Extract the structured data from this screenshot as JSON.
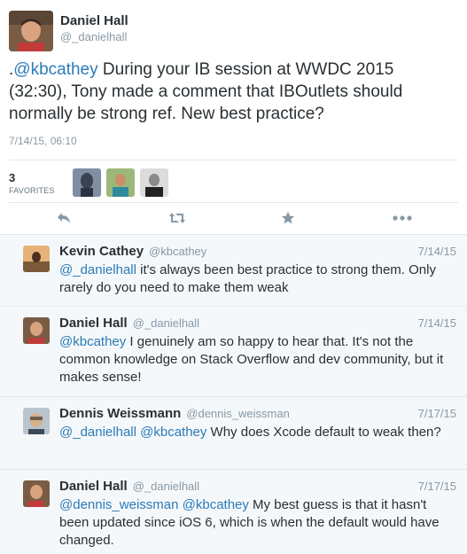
{
  "main": {
    "author_name": "Daniel Hall",
    "author_handle": "@_danielhall",
    "tweet_prefix": ".",
    "tweet_mention": "@kbcathey",
    "tweet_body": " During your IB session at WWDC 2015 (32:30), Tony made a comment that IBOutlets should normally be strong ref. New best practice?",
    "timestamp": "7/14/15, 06:10",
    "favorites_count": "3",
    "favorites_label": "FAVORITES"
  },
  "actions": {
    "reply_icon": "reply-icon",
    "retweet_icon": "retweet-icon",
    "favorite_icon": "star-icon",
    "more_icon": "more-icon"
  },
  "replies": [
    {
      "name": "Kevin Cathey",
      "handle": "@kbcathey",
      "date": "7/14/15",
      "mentions": "@_danielhall",
      "text": " it's always been best practice to strong them. Only rarely do you need to make them weak"
    },
    {
      "name": "Daniel Hall",
      "handle": "@_danielhall",
      "date": "7/14/15",
      "mentions": "@kbcathey",
      "text": " I genuinely am so happy to hear that. It's not the common knowledge on Stack Overflow and dev community, but it makes sense!"
    },
    {
      "name": "Dennis Weissmann",
      "handle": "@dennis_weissman",
      "date": "7/17/15",
      "mentions": "@_danielhall @kbcathey",
      "text": " Why does Xcode default to weak then?"
    },
    {
      "name": "Daniel Hall",
      "handle": "@_danielhall",
      "date": "7/17/15",
      "mentions": "@dennis_weissman @kbcathey",
      "text": " My best guess is that it hasn't been updated since iOS 6, which is when the default would have changed."
    }
  ],
  "colors": {
    "link": "#2b7bb9",
    "text": "#292f33",
    "muted": "#8899a6",
    "reply_bg": "#f5f8fa",
    "border": "#e1e8ed"
  }
}
